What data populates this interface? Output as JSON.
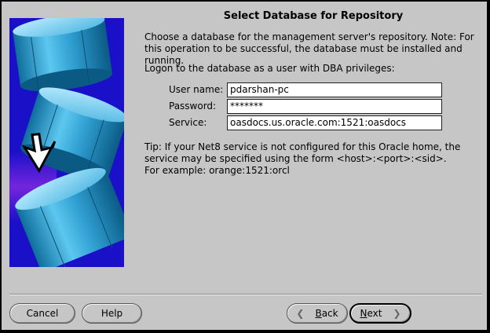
{
  "page": {
    "title": "Select Database for Repository",
    "intro": "Choose a database for the management server's repository. Note: For this operation to be successful, the database must be installed and running.",
    "logon_hint": "Logon to the database as a user with DBA privileges:",
    "tip_line1": "Tip: If your Net8 service is not configured for this Oracle home, the service may be specified using the form <host>:<port>:<sid>.",
    "tip_line2": "For example: orange:1521:orcl"
  },
  "form": {
    "username_label": "User name:",
    "username_value": "pdarshan-pc",
    "password_label": "Password:",
    "password_value": "*******",
    "service_label": "Service:",
    "service_value": "oasdocs.us.oracle.com:1521:oasdocs"
  },
  "buttons": {
    "cancel": "Cancel",
    "help": "Help",
    "back_mnemonic": "B",
    "back_rest": "ack",
    "next_mnemonic": "N",
    "next_rest": "ext"
  },
  "icons": {
    "back": "chevron-left-icon",
    "next": "chevron-right-icon",
    "art": "database-cylinders-illustration"
  },
  "colors": {
    "window_bg": "#c6c6c6",
    "art_bg": "#1a10c8",
    "cylinder": "#3aa8d8"
  }
}
